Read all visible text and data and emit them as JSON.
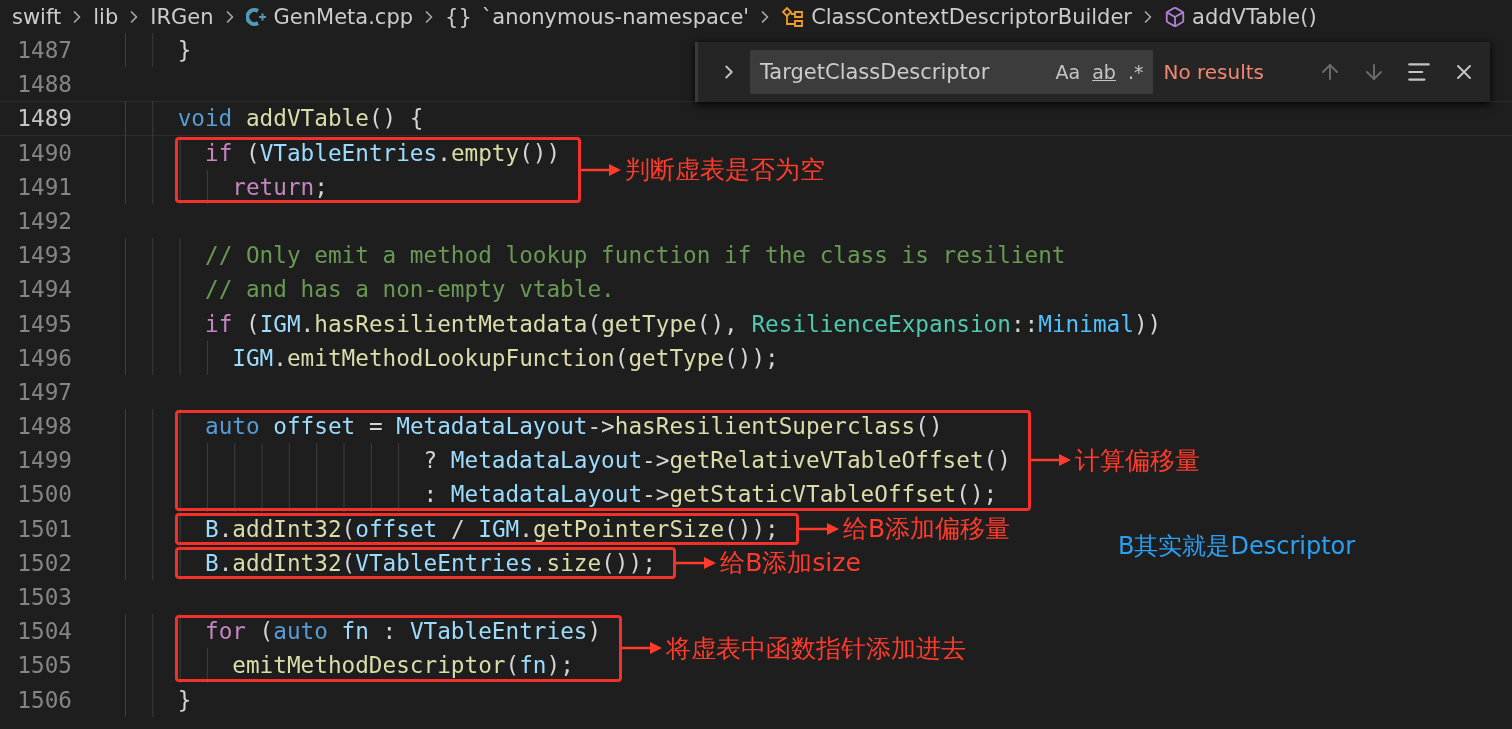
{
  "breadcrumb": [
    {
      "label": "swift",
      "kind": "folder"
    },
    {
      "label": "lib",
      "kind": "folder"
    },
    {
      "label": "IRGen",
      "kind": "folder"
    },
    {
      "label": "GenMeta.cpp",
      "kind": "file"
    },
    {
      "label": "`anonymous-namespace'",
      "kind": "namespace",
      "glyph": "{}"
    },
    {
      "label": "ClassContextDescriptorBuilder",
      "kind": "class"
    },
    {
      "label": "addVTable()",
      "kind": "method"
    }
  ],
  "find_widget": {
    "value": "TargetClassDescriptor",
    "options": [
      "Aa",
      "ab",
      ".*"
    ],
    "status": "No results"
  },
  "blocks": [
    {
      "lines": [
        {
          "number": "1487",
          "current": false,
          "tokens": [
            {
              "text": "    }",
              "kind": "punct"
            }
          ]
        },
        {
          "number": "1488",
          "current": false
        },
        {
          "number": "1489",
          "current": true,
          "tokens": [
            {
              "text": "    void",
              "kind": "kw"
            },
            {
              "text": " addVTable",
              "kind": "fn"
            },
            {
              "text": "() {",
              "kind": "punct"
            }
          ]
        }
      ]
    },
    {
      "note": "判断虚表是否为空",
      "lines": [
        {
          "number": "1490",
          "current": false,
          "tokens": [
            {
              "text": "      if",
              "kind": "ctl"
            },
            {
              "text": " (",
              "kind": "punct"
            },
            {
              "text": "VTableEntries",
              "kind": "var"
            },
            {
              "text": ".",
              "kind": "punct"
            },
            {
              "text": "empty",
              "kind": "fn"
            },
            {
              "text": "())",
              "kind": "punct"
            }
          ]
        },
        {
          "number": "1491",
          "current": false,
          "tokens": [
            {
              "text": "        return",
              "kind": "ctl"
            },
            {
              "text": ";",
              "kind": "punct"
            }
          ]
        }
      ]
    },
    {
      "lines": [
        {
          "number": "1492",
          "current": false
        },
        {
          "number": "1493",
          "current": false,
          "tokens": [
            {
              "text": "      // Only emit a method lookup function if the class is resilient",
              "kind": "cmt"
            }
          ]
        },
        {
          "number": "1494",
          "current": false,
          "tokens": [
            {
              "text": "      // and has a non-empty vtable.",
              "kind": "cmt"
            }
          ]
        },
        {
          "number": "1495",
          "current": false,
          "tokens": [
            {
              "text": "      if",
              "kind": "ctl"
            },
            {
              "text": " (",
              "kind": "punct"
            },
            {
              "text": "IGM",
              "kind": "var"
            },
            {
              "text": ".",
              "kind": "punct"
            },
            {
              "text": "hasResilientMetadata",
              "kind": "fn"
            },
            {
              "text": "(",
              "kind": "punct"
            },
            {
              "text": "getType",
              "kind": "fn"
            },
            {
              "text": "(), ",
              "kind": "punct"
            },
            {
              "text": "ResilienceExpansion",
              "kind": "type"
            },
            {
              "text": "::",
              "kind": "punct"
            },
            {
              "text": "Minimal",
              "kind": "enum"
            },
            {
              "text": "))",
              "kind": "punct"
            }
          ]
        },
        {
          "number": "1496",
          "current": false,
          "tokens": [
            {
              "text": "        IGM",
              "kind": "var"
            },
            {
              "text": ".",
              "kind": "punct"
            },
            {
              "text": "emitMethodLookupFunction",
              "kind": "fn"
            },
            {
              "text": "(",
              "kind": "punct"
            },
            {
              "text": "getType",
              "kind": "fn"
            },
            {
              "text": "());",
              "kind": "punct"
            }
          ]
        },
        {
          "number": "1497",
          "current": false
        }
      ]
    },
    {
      "note": "计算偏移量",
      "lines": [
        {
          "number": "1498",
          "current": false,
          "tokens": [
            {
              "text": "      auto",
              "kind": "kw"
            },
            {
              "text": " offset",
              "kind": "var"
            },
            {
              "text": " = ",
              "kind": "punct"
            },
            {
              "text": "MetadataLayout",
              "kind": "var"
            },
            {
              "text": "->",
              "kind": "punct"
            },
            {
              "text": "hasResilientSuperclass",
              "kind": "fn"
            },
            {
              "text": "()",
              "kind": "punct"
            }
          ]
        },
        {
          "number": "1499",
          "current": false,
          "tokens": [
            {
              "text": "                      ? ",
              "kind": "punct"
            },
            {
              "text": "MetadataLayout",
              "kind": "var"
            },
            {
              "text": "->",
              "kind": "punct"
            },
            {
              "text": "getRelativeVTableOffset",
              "kind": "fn"
            },
            {
              "text": "()",
              "kind": "punct"
            }
          ]
        },
        {
          "number": "1500",
          "current": false,
          "tokens": [
            {
              "text": "                      : ",
              "kind": "punct"
            },
            {
              "text": "MetadataLayout",
              "kind": "var"
            },
            {
              "text": "->",
              "kind": "punct"
            },
            {
              "text": "getStaticVTableOffset",
              "kind": "fn"
            },
            {
              "text": "();",
              "kind": "punct"
            }
          ]
        }
      ]
    },
    {
      "note": "给B添加偏移量",
      "lines": [
        {
          "number": "1501",
          "current": false,
          "tokens": [
            {
              "text": "      B",
              "kind": "var"
            },
            {
              "text": ".",
              "kind": "punct"
            },
            {
              "text": "addInt32",
              "kind": "fn"
            },
            {
              "text": "(",
              "kind": "punct"
            },
            {
              "text": "offset",
              "kind": "var"
            },
            {
              "text": " / ",
              "kind": "punct"
            },
            {
              "text": "IGM",
              "kind": "var"
            },
            {
              "text": ".",
              "kind": "punct"
            },
            {
              "text": "getPointerSize",
              "kind": "fn"
            },
            {
              "text": "());",
              "kind": "punct"
            }
          ]
        }
      ]
    },
    {
      "note": "给B添加size",
      "lines": [
        {
          "number": "1502",
          "current": false,
          "tokens": [
            {
              "text": "      B",
              "kind": "var"
            },
            {
              "text": ".",
              "kind": "punct"
            },
            {
              "text": "addInt32",
              "kind": "fn"
            },
            {
              "text": "(",
              "kind": "punct"
            },
            {
              "text": "VTableEntries",
              "kind": "var"
            },
            {
              "text": ".",
              "kind": "punct"
            },
            {
              "text": "size",
              "kind": "fn"
            },
            {
              "text": "());",
              "kind": "punct"
            }
          ]
        }
      ]
    },
    {
      "lines": [
        {
          "number": "1503",
          "current": false
        }
      ]
    },
    {
      "note": "将虚表中函数指针添加进去",
      "lines": [
        {
          "number": "1504",
          "current": false,
          "tokens": [
            {
              "text": "      for",
              "kind": "ctl"
            },
            {
              "text": " (",
              "kind": "punct"
            },
            {
              "text": "auto",
              "kind": "kw"
            },
            {
              "text": " fn",
              "kind": "var"
            },
            {
              "text": " : ",
              "kind": "punct"
            },
            {
              "text": "VTableEntries",
              "kind": "var"
            },
            {
              "text": ")",
              "kind": "punct"
            }
          ]
        },
        {
          "number": "1505",
          "current": false,
          "tokens": [
            {
              "text": "        emitMethodDescriptor",
              "kind": "fn"
            },
            {
              "text": "(",
              "kind": "punct"
            },
            {
              "text": "fn",
              "kind": "var"
            },
            {
              "text": ");",
              "kind": "punct"
            }
          ]
        }
      ]
    },
    {
      "lines": [
        {
          "number": "1506",
          "current": false,
          "tokens": [
            {
              "text": "    }",
              "kind": "punct"
            }
          ]
        }
      ]
    }
  ],
  "side_note": "B其实就是Descriptor"
}
